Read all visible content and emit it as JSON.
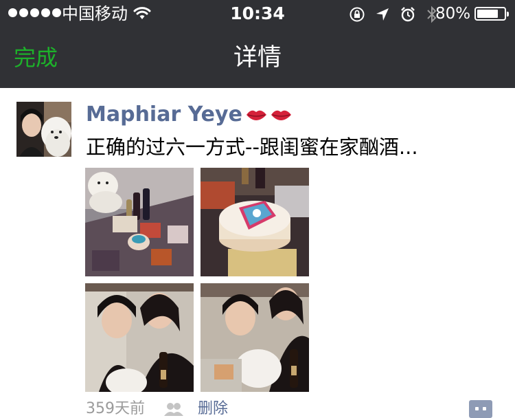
{
  "status_bar": {
    "carrier": "中国移动",
    "time": "10:34",
    "battery_percent": "80%",
    "battery_level": 0.8,
    "icons": [
      "signal-dots-icon",
      "wifi-icon",
      "orientation-lock-icon",
      "location-arrow-icon",
      "alarm-icon",
      "bluetooth-icon",
      "battery-icon"
    ]
  },
  "nav": {
    "back_label": "完成",
    "title": "详情"
  },
  "post": {
    "username": "Maphiar Yeye",
    "username_emoji": "lips-icon",
    "text": "正确的过六一方式--跟闺蜜在家酗酒...",
    "photos": [
      "dog-and-wine-table-photo",
      "doraemon-cake-photo",
      "girls-selfie-photo-1",
      "girls-selfie-photo-2"
    ],
    "time_ago": "359天前",
    "visibility_icon": "friends-icon",
    "delete_label": "删除",
    "comment_icon": "comment-icon"
  },
  "colors": {
    "bar_background": "#303135",
    "accent_green": "#1db12a",
    "link_blue": "#576b95",
    "meta_gray": "#9a9a9a",
    "comment_button": "#8e9bb5"
  }
}
